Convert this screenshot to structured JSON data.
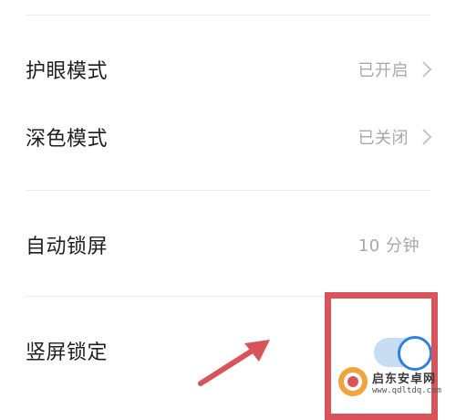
{
  "settings": {
    "eye_protection": {
      "label": "护眼模式",
      "value": "已开启"
    },
    "dark_mode": {
      "label": "深色模式",
      "value": "已关闭"
    },
    "auto_lock": {
      "label": "自动锁屏",
      "value": "10 分钟"
    },
    "portrait_lock": {
      "label": "竖屏锁定",
      "enabled": true
    }
  },
  "colors": {
    "toggle_accent": "#2a82e4",
    "highlight": "#d8535a"
  },
  "icons": [
    "chevron-right-icon",
    "annotation-arrow",
    "watermark-logo"
  ],
  "watermark": {
    "name": "启东安卓网",
    "url": "www.qdltdq.com"
  }
}
